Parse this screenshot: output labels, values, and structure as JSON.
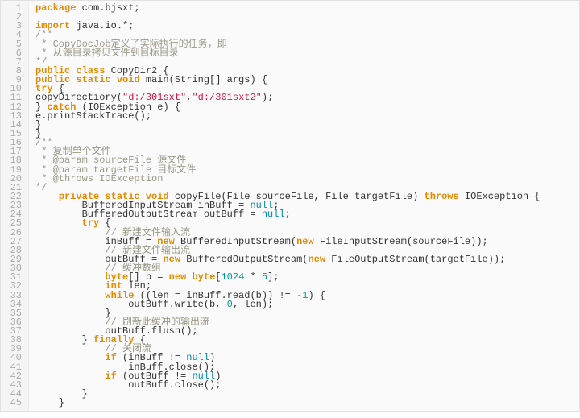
{
  "lines": [
    {
      "n": 1,
      "segs": [
        {
          "t": "package",
          "c": "kw2"
        },
        {
          "t": " com.bjsxt;"
        }
      ]
    },
    {
      "n": 2,
      "segs": []
    },
    {
      "n": 3,
      "segs": [
        {
          "t": "import",
          "c": "kw2"
        },
        {
          "t": " java.io.*;"
        }
      ]
    },
    {
      "n": 4,
      "segs": [
        {
          "t": "/**",
          "c": "cmt"
        }
      ]
    },
    {
      "n": 5,
      "segs": [
        {
          "t": " * CopyDocJob定义了实际执行的任务，即",
          "c": "cmt"
        }
      ]
    },
    {
      "n": 6,
      "segs": [
        {
          "t": " * 从源目录拷贝文件到目标目录",
          "c": "cmt"
        }
      ]
    },
    {
      "n": 7,
      "segs": [
        {
          "t": "*/",
          "c": "cmt"
        }
      ]
    },
    {
      "n": 8,
      "segs": [
        {
          "t": "public class",
          "c": "kw2"
        },
        {
          "t": " CopyDir2 {"
        }
      ]
    },
    {
      "n": 9,
      "segs": [
        {
          "t": "public static void",
          "c": "kw2"
        },
        {
          "t": " main(String[] args) {"
        }
      ]
    },
    {
      "n": 10,
      "segs": [
        {
          "t": "try",
          "c": "kw2"
        },
        {
          "t": " {"
        }
      ]
    },
    {
      "n": 11,
      "segs": [
        {
          "t": "copyDirectiory("
        },
        {
          "t": "\"d:/301sxt\"",
          "c": "str"
        },
        {
          "t": ","
        },
        {
          "t": "\"d:/301sxt2\"",
          "c": "str"
        },
        {
          "t": ");"
        }
      ]
    },
    {
      "n": 12,
      "segs": [
        {
          "t": "} "
        },
        {
          "t": "catch",
          "c": "kw2"
        },
        {
          "t": " (IOException e) {"
        }
      ]
    },
    {
      "n": 13,
      "segs": [
        {
          "t": "e.printStackTrace();"
        }
      ]
    },
    {
      "n": 14,
      "segs": [
        {
          "t": "}"
        }
      ]
    },
    {
      "n": 15,
      "segs": [
        {
          "t": "}"
        }
      ]
    },
    {
      "n": 16,
      "segs": [
        {
          "t": "/**",
          "c": "cmt"
        }
      ]
    },
    {
      "n": 17,
      "segs": [
        {
          "t": " * 复制单个文件",
          "c": "cmt"
        }
      ]
    },
    {
      "n": 18,
      "segs": [
        {
          "t": " * @param sourceFile 源文件",
          "c": "cmt"
        }
      ]
    },
    {
      "n": 19,
      "segs": [
        {
          "t": " * @param targetFile 目标文件",
          "c": "cmt"
        }
      ]
    },
    {
      "n": 20,
      "segs": [
        {
          "t": " * @throws IOException",
          "c": "cmt"
        }
      ]
    },
    {
      "n": 21,
      "segs": [
        {
          "t": "*/",
          "c": "cmt"
        }
      ]
    },
    {
      "n": 22,
      "segs": [
        {
          "t": "    "
        },
        {
          "t": "private static void",
          "c": "kw2"
        },
        {
          "t": " copyFile(File sourceFile, File targetFile) "
        },
        {
          "t": "throws",
          "c": "kw3"
        },
        {
          "t": " IOException {"
        }
      ]
    },
    {
      "n": 23,
      "segs": [
        {
          "t": "        BufferedInputStream inBuff = "
        },
        {
          "t": "null",
          "c": "lit"
        },
        {
          "t": ";"
        }
      ]
    },
    {
      "n": 24,
      "segs": [
        {
          "t": "        BufferedOutputStream outBuff = "
        },
        {
          "t": "null",
          "c": "lit"
        },
        {
          "t": ";"
        }
      ]
    },
    {
      "n": 25,
      "segs": [
        {
          "t": "        "
        },
        {
          "t": "try",
          "c": "kw2"
        },
        {
          "t": " {"
        }
      ]
    },
    {
      "n": 26,
      "segs": [
        {
          "t": "            "
        },
        {
          "t": "// 新建文件输入流",
          "c": "cmt"
        }
      ]
    },
    {
      "n": 27,
      "segs": [
        {
          "t": "            inBuff = "
        },
        {
          "t": "new",
          "c": "kw3"
        },
        {
          "t": " BufferedInputStream("
        },
        {
          "t": "new",
          "c": "kw3"
        },
        {
          "t": " FileInputStream(sourceFile));"
        }
      ]
    },
    {
      "n": 28,
      "segs": [
        {
          "t": "            "
        },
        {
          "t": "// 新建文件输出流",
          "c": "cmt"
        }
      ]
    },
    {
      "n": 29,
      "segs": [
        {
          "t": "            outBuff = "
        },
        {
          "t": "new",
          "c": "kw3"
        },
        {
          "t": " BufferedOutputStream("
        },
        {
          "t": "new",
          "c": "kw3"
        },
        {
          "t": " FileOutputStream(targetFile));"
        }
      ]
    },
    {
      "n": 30,
      "segs": [
        {
          "t": "            "
        },
        {
          "t": "// 缓冲数组",
          "c": "cmt"
        }
      ]
    },
    {
      "n": 31,
      "segs": [
        {
          "t": "            "
        },
        {
          "t": "byte",
          "c": "kw2"
        },
        {
          "t": "[] b = "
        },
        {
          "t": "new",
          "c": "kw3"
        },
        {
          "t": " "
        },
        {
          "t": "byte",
          "c": "kw2"
        },
        {
          "t": "["
        },
        {
          "t": "1024",
          "c": "num"
        },
        {
          "t": " * "
        },
        {
          "t": "5",
          "c": "num"
        },
        {
          "t": "];"
        }
      ]
    },
    {
      "n": 32,
      "segs": [
        {
          "t": "            "
        },
        {
          "t": "int",
          "c": "kw2"
        },
        {
          "t": " len;"
        }
      ]
    },
    {
      "n": 33,
      "segs": [
        {
          "t": "            "
        },
        {
          "t": "while",
          "c": "kw2"
        },
        {
          "t": " ((len = inBuff.read(b)) != -"
        },
        {
          "t": "1",
          "c": "num"
        },
        {
          "t": ") {"
        }
      ]
    },
    {
      "n": 34,
      "segs": [
        {
          "t": "                outBuff.write(b, "
        },
        {
          "t": "0",
          "c": "num"
        },
        {
          "t": ", len);"
        }
      ]
    },
    {
      "n": 35,
      "segs": [
        {
          "t": "            }"
        }
      ]
    },
    {
      "n": 36,
      "segs": [
        {
          "t": "            "
        },
        {
          "t": "// 刷新此缓冲的输出流",
          "c": "cmt"
        }
      ]
    },
    {
      "n": 37,
      "segs": [
        {
          "t": "            outBuff.flush();"
        }
      ]
    },
    {
      "n": 38,
      "segs": [
        {
          "t": "        } "
        },
        {
          "t": "finally",
          "c": "kw2"
        },
        {
          "t": " {"
        }
      ]
    },
    {
      "n": 39,
      "segs": [
        {
          "t": "            "
        },
        {
          "t": "// 关闭流",
          "c": "cmt"
        }
      ]
    },
    {
      "n": 40,
      "segs": [
        {
          "t": "            "
        },
        {
          "t": "if",
          "c": "kw2"
        },
        {
          "t": " (inBuff != "
        },
        {
          "t": "null",
          "c": "lit"
        },
        {
          "t": ")"
        }
      ]
    },
    {
      "n": 41,
      "segs": [
        {
          "t": "                inBuff.close();"
        }
      ]
    },
    {
      "n": 42,
      "segs": [
        {
          "t": "            "
        },
        {
          "t": "if",
          "c": "kw2"
        },
        {
          "t": " (outBuff != "
        },
        {
          "t": "null",
          "c": "lit"
        },
        {
          "t": ")"
        }
      ]
    },
    {
      "n": 43,
      "segs": [
        {
          "t": "                outBuff.close();"
        }
      ]
    },
    {
      "n": 44,
      "segs": [
        {
          "t": "        }"
        }
      ]
    },
    {
      "n": 45,
      "segs": [
        {
          "t": "    }"
        }
      ]
    }
  ]
}
